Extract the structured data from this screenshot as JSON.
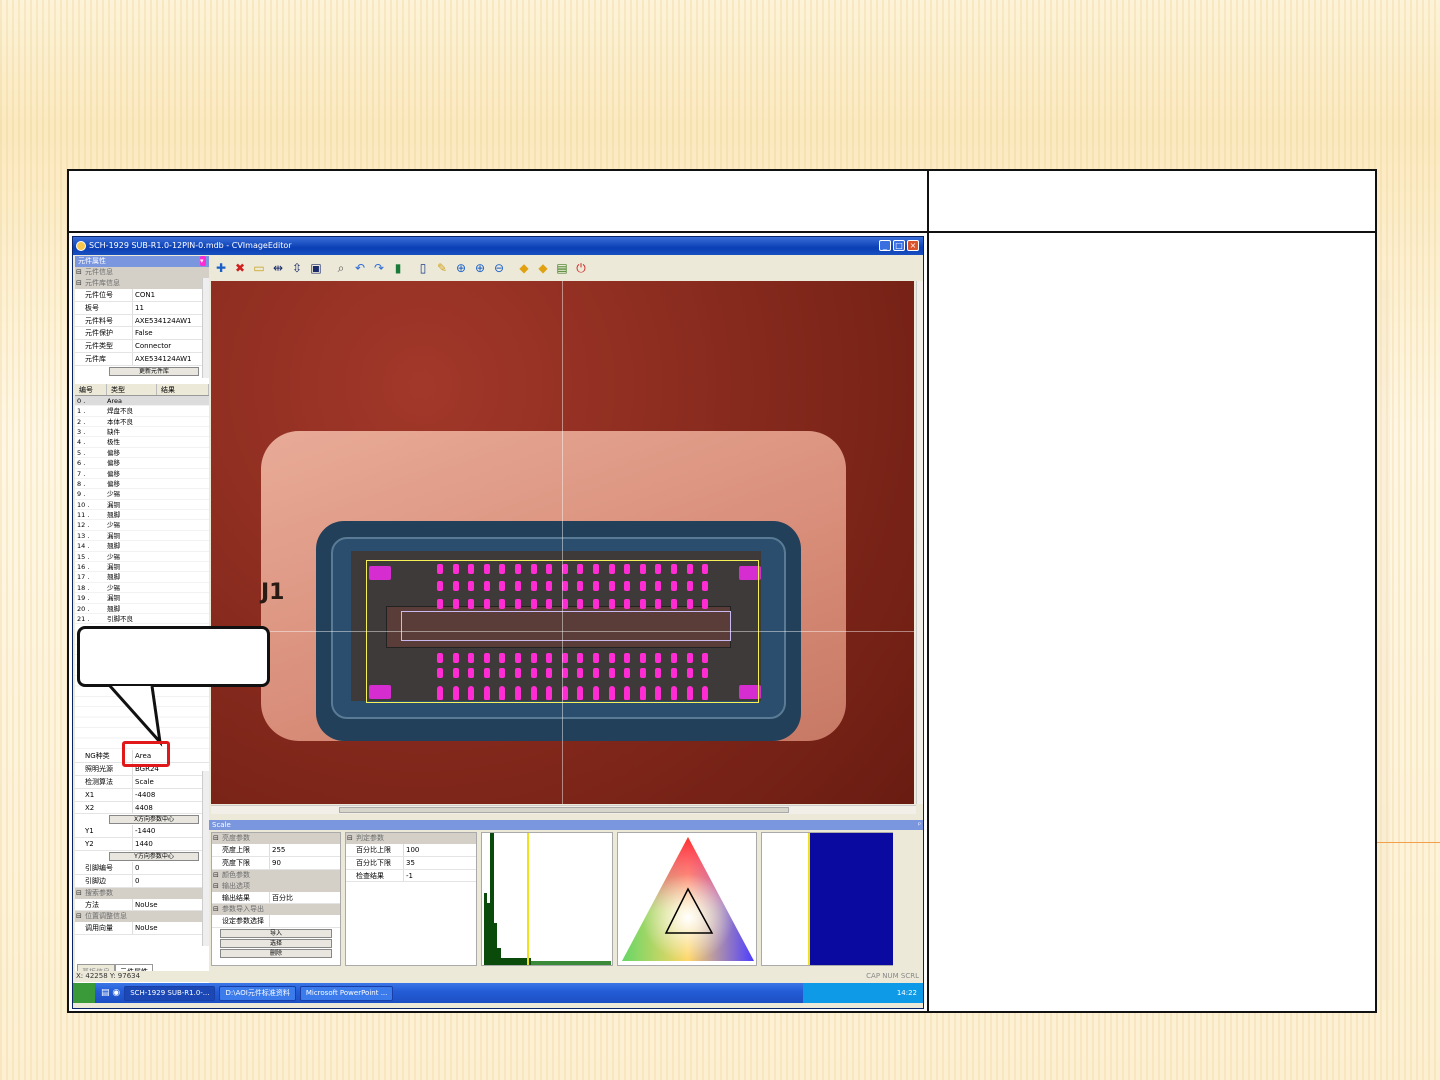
{
  "window": {
    "title": "SCH-1929 SUB-R1.0-12PIN-0.mdb - CVImageEditor"
  },
  "left_panel": {
    "header": "元件属性",
    "top_categories": [
      "元件信息",
      "元件库信息"
    ],
    "props": [
      {
        "k": "元件位号",
        "v": "CON1"
      },
      {
        "k": "板号",
        "v": "11"
      },
      {
        "k": "元件料号",
        "v": "AXE534124AW1"
      },
      {
        "k": "元件保护",
        "v": "False"
      },
      {
        "k": "元件类型",
        "v": "Connector"
      },
      {
        "k": "元件库",
        "v": "AXE534124AW1"
      }
    ],
    "top_button": "更新元件库",
    "list_headers": [
      "编号",
      "类型",
      "结果"
    ],
    "list_rows": [
      {
        "n": "0 .",
        "t": "Area"
      },
      {
        "n": "1 .",
        "t": "焊盘不良"
      },
      {
        "n": "2 .",
        "t": "本体不良"
      },
      {
        "n": "3 .",
        "t": "缺件"
      },
      {
        "n": "4 .",
        "t": "极性"
      },
      {
        "n": "5 .",
        "t": "偏移"
      },
      {
        "n": "6 .",
        "t": "偏移"
      },
      {
        "n": "7 .",
        "t": "偏移"
      },
      {
        "n": "8 .",
        "t": "偏移"
      },
      {
        "n": "9 .",
        "t": "少锡"
      },
      {
        "n": "10 .",
        "t": "漏铜"
      },
      {
        "n": "11 .",
        "t": "翘脚"
      },
      {
        "n": "12 .",
        "t": "少锡"
      },
      {
        "n": "13 .",
        "t": "漏铜"
      },
      {
        "n": "14 .",
        "t": "翘脚"
      },
      {
        "n": "15 .",
        "t": "少锡"
      },
      {
        "n": "16 .",
        "t": "漏铜"
      },
      {
        "n": "17 .",
        "t": "翘脚"
      },
      {
        "n": "18 .",
        "t": "少锡"
      },
      {
        "n": "19 .",
        "t": "漏铜"
      },
      {
        "n": "20 .",
        "t": "翘脚"
      },
      {
        "n": "21 .",
        "t": "引脚不良"
      }
    ],
    "lower_props": [
      {
        "k": "NG种类",
        "v": "Area"
      },
      {
        "k": "照明光源",
        "v": "BGR24"
      },
      {
        "k": "检测算法",
        "v": "Scale"
      },
      {
        "k": "X1",
        "v": "-4408"
      },
      {
        "k": "X2",
        "v": "4408"
      }
    ],
    "btn_x_center": "X方向参数中心",
    "lower_props2": [
      {
        "k": "Y1",
        "v": "-1440"
      },
      {
        "k": "Y2",
        "v": "1440"
      }
    ],
    "btn_y_center": "Y方向参数中心",
    "lower_props3": [
      {
        "k": "引脚编号",
        "v": "0"
      },
      {
        "k": "引脚边",
        "v": "0"
      }
    ],
    "cat_detect": "搜索参数",
    "method_row": {
      "k": "方法",
      "v": "NoUse"
    },
    "cat_adjust": "位置调整信息",
    "adjust_row": {
      "k": "调用向量",
      "v": "NoUse"
    },
    "tabs": [
      "基板信息",
      "元件属性"
    ]
  },
  "bottom_panel": {
    "header": "Scale",
    "left_grid": {
      "cat1": "亮度参数",
      "rows1": [
        {
          "k": "亮度上限",
          "v": "255"
        },
        {
          "k": "亮度下限",
          "v": "90"
        }
      ],
      "cat2": "颜色参数",
      "cat3": "输出选项",
      "rows3": [
        {
          "k": "输出结果",
          "v": "百分比"
        }
      ],
      "cat4": "参数导入导出",
      "rows4": [
        {
          "k": "设定参数选择",
          "v": ""
        }
      ],
      "buttons": [
        "导入",
        "选择",
        "删除"
      ]
    },
    "right_grid": {
      "cat": "判定参数",
      "rows": [
        {
          "k": "百分比上限",
          "v": "100"
        },
        {
          "k": "百分比下限",
          "v": "35"
        },
        {
          "k": "检查结果",
          "v": "-1"
        }
      ]
    }
  },
  "statusbar": {
    "coords": "X: 42258 Y: 97634",
    "indicators": "CAP  NUM  SCRL"
  },
  "taskbar": {
    "items": [
      "SCH-1929 SUB-R1.0-...",
      "D:\\AOI元件标准资料",
      "Microsoft PowerPoint ..."
    ],
    "time": "14:22"
  },
  "image_view": {
    "silkscreen": "J1"
  },
  "colors": {
    "accent": "#0a246a",
    "highlight": "#e0181a",
    "pins": "#ff2bd3",
    "roi": "#f4f055"
  }
}
